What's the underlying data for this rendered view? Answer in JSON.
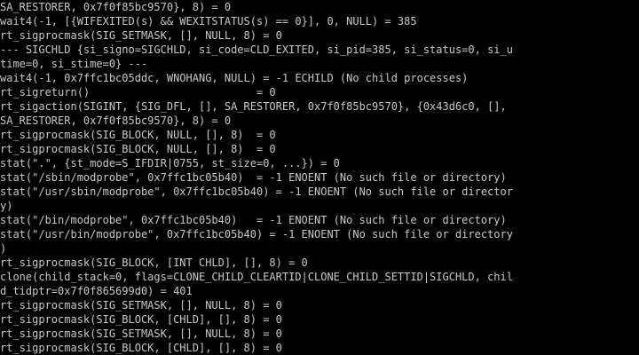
{
  "terminal": {
    "lines": [
      "SA_RESTORER, 0x7f0f85bc9570}, 8) = 0",
      "wait4(-1, [{WIFEXITED(s) && WEXITSTATUS(s) == 0}], 0, NULL) = 385",
      "rt_sigprocmask(SIG_SETMASK, [], NULL, 8) = 0",
      "--- SIGCHLD {si_signo=SIGCHLD, si_code=CLD_EXITED, si_pid=385, si_status=0, si_u",
      "time=0, si_stime=0} ---",
      "wait4(-1, 0x7ffc1bc05ddc, WNOHANG, NULL) = -1 ECHILD (No child processes)",
      "rt_sigreturn()                          = 0",
      "rt_sigaction(SIGINT, {SIG_DFL, [], SA_RESTORER, 0x7f0f85bc9570}, {0x43d6c0, [],",
      "SA_RESTORER, 0x7f0f85bc9570}, 8) = 0",
      "rt_sigprocmask(SIG_BLOCK, NULL, [], 8)  = 0",
      "rt_sigprocmask(SIG_BLOCK, NULL, [], 8)  = 0",
      "stat(\".\", {st_mode=S_IFDIR|0755, st_size=0, ...}) = 0",
      "stat(\"/sbin/modprobe\", 0x7ffc1bc05b40)  = -1 ENOENT (No such file or directory)",
      "stat(\"/usr/sbin/modprobe\", 0x7ffc1bc05b40) = -1 ENOENT (No such file or director",
      "y)",
      "stat(\"/bin/modprobe\", 0x7ffc1bc05b40)   = -1 ENOENT (No such file or directory)",
      "stat(\"/usr/bin/modprobe\", 0x7ffc1bc05b40) = -1 ENOENT (No such file or directory",
      ")",
      "rt_sigprocmask(SIG_BLOCK, [INT CHLD], [], 8) = 0",
      "clone(child_stack=0, flags=CLONE_CHILD_CLEARTID|CLONE_CHILD_SETTID|SIGCHLD, chil",
      "d_tidptr=0x7f0f865699d0) = 401",
      "rt_sigprocmask(SIG_SETMASK, [], NULL, 8) = 0",
      "rt_sigprocmask(SIG_BLOCK, [CHLD], [], 8) = 0",
      "rt_sigprocmask(SIG_SETMASK, [], NULL, 8) = 0",
      "rt_sigprocmask(SIG_BLOCK, [CHLD], [], 8) = 0"
    ]
  },
  "colors": {
    "background": "#000000",
    "foreground": "#c9c9c9"
  }
}
